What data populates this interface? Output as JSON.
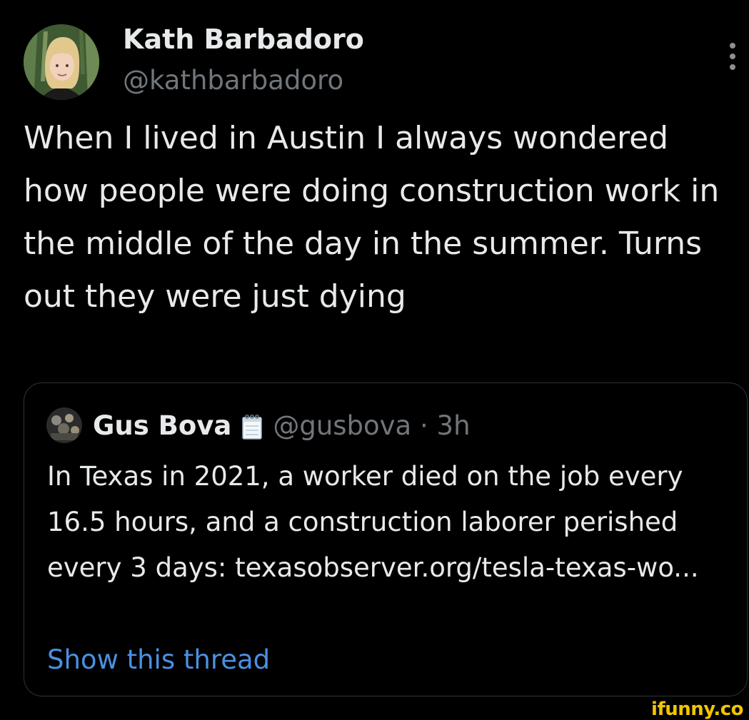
{
  "tweet": {
    "author": {
      "name": "Kath Barbadoro",
      "handle": "@kathbarbadoro"
    },
    "text": "When I lived in Austin I always wondered how people were doing construction work in the middle of the day in the summer. Turns out they were just dying",
    "more_icon": "more-vertical-icon"
  },
  "quote": {
    "author": {
      "name": "Gus Bova",
      "emoji": "notepad-icon",
      "handle": "@gusbova",
      "separator": "·",
      "time": "3h"
    },
    "text": "In Texas in 2021, a worker died on the job every 16.5 hours, and a construction laborer perished every 3 days: texasobserver.org/tesla-texas-wo...",
    "show_thread": "Show this thread"
  },
  "watermark": "ifunny.co",
  "colors": {
    "background": "#000000",
    "text": "#e7e9ea",
    "secondary": "#71767b",
    "link": "#4a90e2",
    "border": "#2f3336",
    "watermark": "#f2c500"
  }
}
